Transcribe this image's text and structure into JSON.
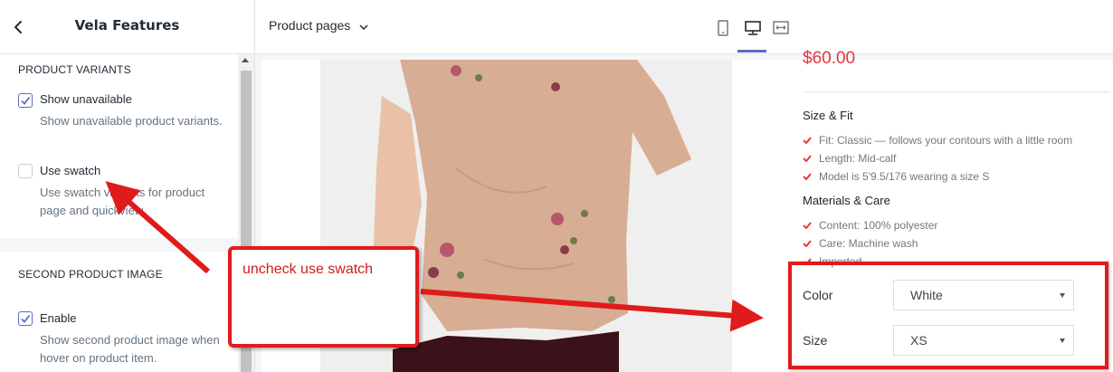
{
  "sidebar": {
    "title": "Vela Features",
    "sections": [
      {
        "heading": "PRODUCT VARIANTS",
        "options": [
          {
            "label": "Show unavailable",
            "checked": true,
            "help": "Show unavailable product variants."
          },
          {
            "label": "Use swatch",
            "checked": false,
            "help": "Use swatch variants for product page and quickview."
          }
        ]
      },
      {
        "heading": "SECOND PRODUCT IMAGE",
        "options": [
          {
            "label": "Enable",
            "checked": true,
            "help": "Show second product image when hover on product item."
          }
        ]
      }
    ]
  },
  "topbar": {
    "page_selector": "Product pages",
    "device_icons": [
      "mobile-icon",
      "desktop-icon",
      "fullscreen-icon"
    ],
    "active_device": "desktop-icon"
  },
  "product": {
    "price": "$60.00",
    "size_fit": {
      "heading": "Size & Fit",
      "items": [
        "Fit: Classic — follows your contours with a little room",
        "Length: Mid-calf",
        "Model is 5'9.5/176 wearing a size S"
      ]
    },
    "materials": {
      "heading": "Materials & Care",
      "items": [
        "Content: 100% polyester",
        "Care: Machine wash",
        "Imported"
      ]
    },
    "options": {
      "color_label": "Color",
      "color_value": "White",
      "size_label": "Size",
      "size_value": "XS"
    }
  },
  "annotation": {
    "callout_text": "uncheck use swatch",
    "color": "#e01b1b"
  },
  "colors": {
    "accent": "#5c6ac4",
    "price": "#e8353b",
    "check": "#e8353b"
  }
}
